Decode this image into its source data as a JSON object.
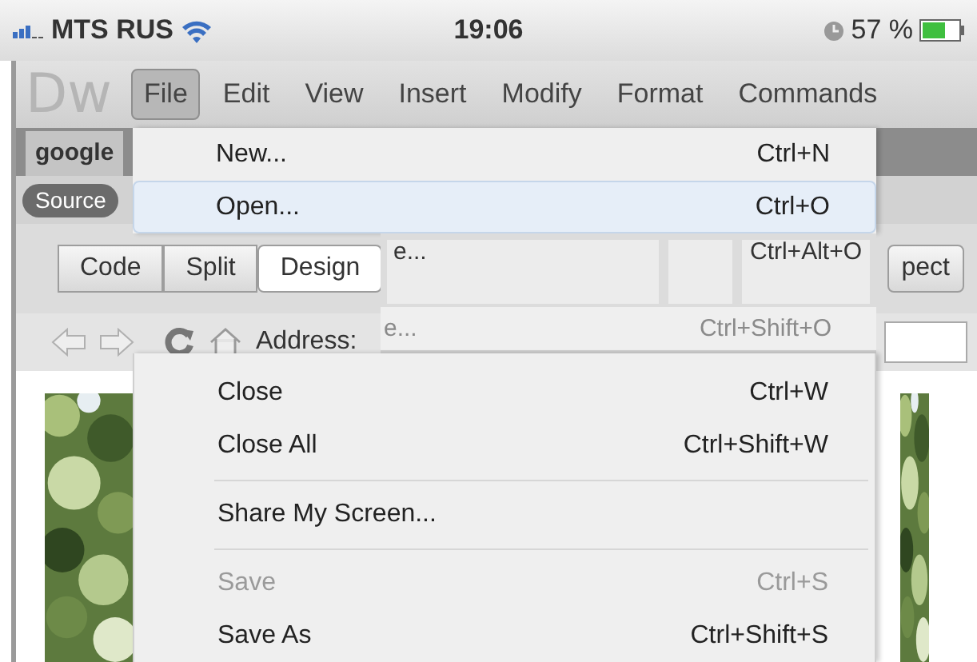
{
  "status_bar": {
    "carrier": "MTS RUS",
    "time": "19:06",
    "battery": "57 %"
  },
  "menu_bar": {
    "logo": "Dw",
    "menus": [
      {
        "label": "File",
        "selected": true
      },
      {
        "label": "Edit",
        "selected": false
      },
      {
        "label": "View",
        "selected": false
      },
      {
        "label": "Insert",
        "selected": false
      },
      {
        "label": "Modify",
        "selected": false
      },
      {
        "label": "Format",
        "selected": false
      },
      {
        "label": "Commands",
        "selected": false
      }
    ]
  },
  "document_tab": "google",
  "source_button": "Source",
  "view_buttons": [
    {
      "label": "Code",
      "selected": false
    },
    {
      "label": "Split",
      "selected": false
    },
    {
      "label": "Design",
      "selected": true
    }
  ],
  "toolbar_fragments": [
    "e...",
    "Ctrl+Alt+O"
  ],
  "inspect_button": "pect",
  "address_label": "Address:",
  "file_menu": {
    "items": [
      {
        "kind": "item",
        "label": "New...",
        "shortcut": "Ctrl+N",
        "selected": false,
        "disabled": false
      },
      {
        "kind": "item",
        "label": "Open...",
        "shortcut": "Ctrl+O",
        "selected": true,
        "disabled": false
      },
      {
        "kind": "overlap",
        "label": "e...",
        "shortcut": "Ctrl+Shift+O"
      },
      {
        "kind": "item",
        "label": "Close",
        "shortcut": "Ctrl+W",
        "selected": false,
        "disabled": false
      },
      {
        "kind": "item",
        "label": "Close All",
        "shortcut": "Ctrl+Shift+W",
        "selected": false,
        "disabled": false
      },
      {
        "kind": "separator"
      },
      {
        "kind": "item",
        "label": "Share My Screen...",
        "selected": false,
        "disabled": false
      },
      {
        "kind": "separator"
      },
      {
        "kind": "item",
        "label": "Save",
        "shortcut": "Ctrl+S",
        "selected": false,
        "disabled": true
      },
      {
        "kind": "item",
        "label": "Save As",
        "shortcut": "Ctrl+Shift+S",
        "selected": false,
        "disabled": false
      }
    ]
  }
}
